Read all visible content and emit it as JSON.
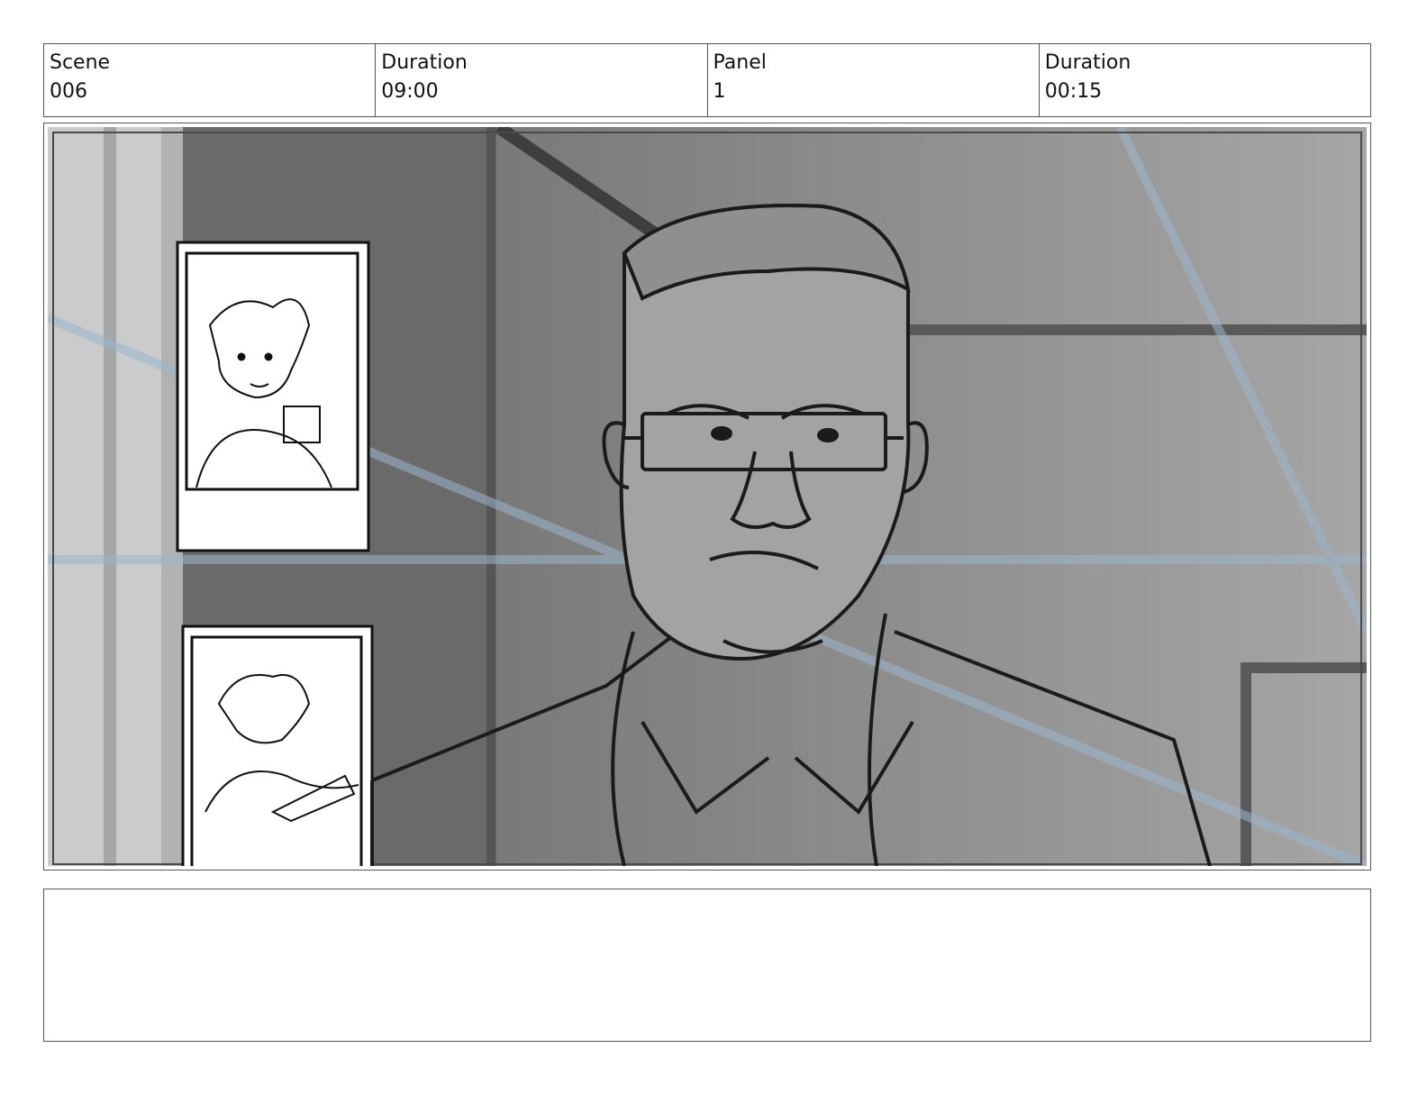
{
  "header": {
    "scene_label": "Scene",
    "scene_value": "006",
    "scene_duration_label": "Duration",
    "scene_duration_value": "09:00",
    "panel_label": "Panel",
    "panel_value": "1",
    "panel_duration_label": "Duration",
    "panel_duration_value": "00:15"
  },
  "notes": {
    "text": ""
  }
}
